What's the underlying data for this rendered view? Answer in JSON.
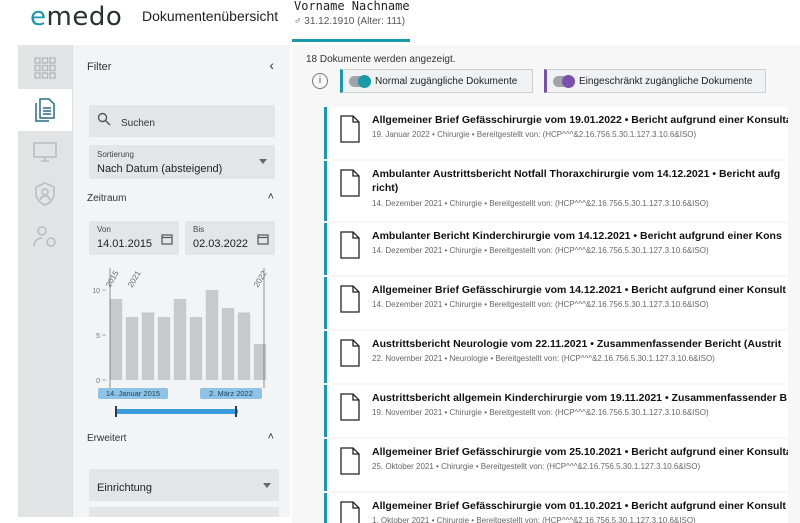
{
  "header": {
    "logo": "emedo",
    "app_title": "Dokumentenübersicht",
    "patient_name": "Vorname Nachname",
    "patient_dob": "♂ 31.12.1910 (Alter: 111)"
  },
  "rail": {
    "items": [
      {
        "icon": "grid-icon"
      },
      {
        "icon": "documents-icon",
        "active": true
      },
      {
        "icon": "monitor-icon"
      },
      {
        "icon": "shield-user-icon"
      },
      {
        "icon": "user-settings-icon"
      }
    ]
  },
  "filter": {
    "header": "Filter",
    "search_placeholder": "Suchen",
    "sort_label": "Sortierung",
    "sort_value": "Nach Datum (absteigend)",
    "zeitraum_label": "Zeitraum",
    "from_label": "Von",
    "from_value": "14.01.2015",
    "to_label": "Bis",
    "to_value": "02.03.2022",
    "erweitert_label": "Erweitert",
    "einrichtung_label": "Einrichtung"
  },
  "chart_data": {
    "type": "bar",
    "categories": [
      "2015",
      "",
      "",
      "",
      "",
      "",
      "",
      "",
      "",
      "2022"
    ],
    "values": [
      9,
      7,
      7.5,
      7,
      9,
      7,
      10,
      8,
      7.5,
      4
    ],
    "ylim": [
      0,
      10
    ],
    "yticks": [
      "0",
      "5",
      "10"
    ],
    "rotated_labels": [
      "2015",
      "2021",
      "2022"
    ],
    "range_start_label": "14. Januar 2015",
    "range_end_label": "2. März 2022",
    "bar_color": "#c7c9cc",
    "highlight_color": "#8fc3e6"
  },
  "main": {
    "count_text": "18 Dokumente werden angezeigt.",
    "toggle_normal": "Normal zugängliche Dokumente",
    "toggle_restricted": "Eingeschränkt zugängliche Dokumente",
    "accent": "#1a9aa8",
    "restricted_accent": "#7a4fb0"
  },
  "documents": [
    {
      "title": "Allgemeiner Brief Gefässchirurgie vom 19.01.2022  •  Bericht aufgrund einer Konsulta",
      "title2": "",
      "meta": "19. Januar 2022  •  Chirurgie  •  Bereitgestellt von: (HCP^^^&2.16.756.5.30.1.127.3.10.6&ISO)"
    },
    {
      "title": "Ambulanter Austrittsbericht Notfall Thoraxchirurgie vom 14.12.2021  •  Bericht aufg",
      "title2": "richt)",
      "meta": "14. Dezember 2021  •  Chirurgie  •  Bereitgestellt von: (HCP^^^&2.16.756.5.30.1.127.3.10.6&ISO)"
    },
    {
      "title": "Ambulanter Bericht Kinderchirurgie vom 14.12.2021  •  Bericht aufgrund einer Kons",
      "title2": "",
      "meta": "14. Dezember 2021  •  Chirurgie  •  Bereitgestellt von: (HCP^^^&2.16.756.5.30.1.127.3.10.6&ISO)"
    },
    {
      "title": "Allgemeiner Brief Gefässchirurgie vom 14.12.2021  •  Bericht aufgrund einer Konsult",
      "title2": "",
      "meta": "14. Dezember 2021  •  Chirurgie  •  Bereitgestellt von: (HCP^^^&2.16.756.5.30.1.127.3.10.6&ISO)"
    },
    {
      "title": "Austrittsbericht Neurologie vom 22.11.2021  •  Zusammenfassender Bericht (Austrit",
      "title2": "",
      "meta": "22. November 2021  •  Neurologie  •  Bereitgestellt von: (HCP^^^&2.16.756.5.30.1.127.3.10.6&ISO)"
    },
    {
      "title": "Austrittsbericht allgemein Kinderchirurgie vom 19.11.2021  •  Zusammenfassender B",
      "title2": "",
      "meta": "19. November 2021  •  Chirurgie  •  Bereitgestellt von: (HCP^^^&2.16.756.5.30.1.127.3.10.6&ISO)"
    },
    {
      "title": "Allgemeiner Brief Gefässchirurgie vom 25.10.2021  •  Bericht aufgrund einer Konsulta",
      "title2": "",
      "meta": "25. Oktober 2021  •  Chirurgie  •  Bereitgestellt von: (HCP^^^&2.16.756.5.30.1.127.3.10.6&ISO)"
    },
    {
      "title": "Allgemeiner Brief Gefässchirurgie vom 01.10.2021  •  Bericht aufgrund einer Konsult",
      "title2": "",
      "meta": "1. Oktober 2021  •  Chirurgie  •  Bereitgestellt von: (HCP^^^&2.16.756.5.30.1.127.3.10.6&ISO)"
    }
  ]
}
